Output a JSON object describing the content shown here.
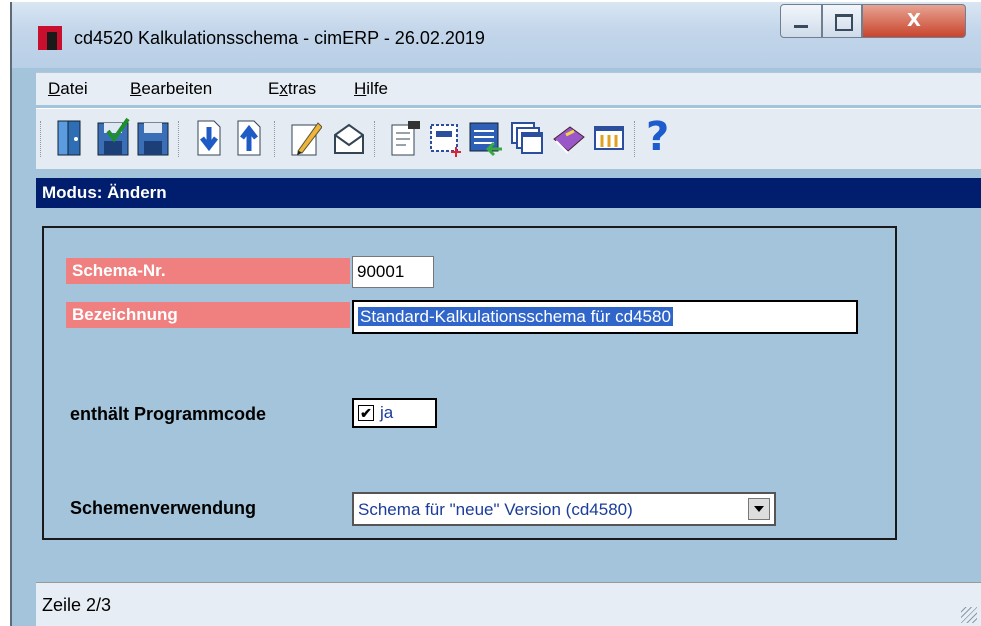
{
  "window": {
    "title": "cd4520 Kalkulationsschema - cimERP - 26.02.2019",
    "close_glyph": "X"
  },
  "menu": [
    {
      "label": "Datei",
      "access": "D",
      "rest": "atei"
    },
    {
      "label": "Bearbeiten",
      "access": "B",
      "rest": "earbeiten"
    },
    {
      "label": "Extras",
      "access": "x",
      "pre": "E",
      "rest": "tras"
    },
    {
      "label": "Hilfe",
      "access": "H",
      "rest": "ilfe"
    }
  ],
  "toolbar": {
    "icons": [
      "exit-door-icon",
      "save-checked-icon",
      "save-icon",
      "arrow-down-icon",
      "arrow-up-icon",
      "edit-pencil-icon",
      "mail-icon",
      "form-icon",
      "new-field-icon",
      "list-transfer-icon",
      "windows-icon",
      "book-icon",
      "grid-icon",
      "help-icon"
    ],
    "help_glyph": "?"
  },
  "mode": {
    "text": "Modus: Ändern"
  },
  "form": {
    "schema_nr": {
      "label": "Schema-Nr.",
      "value": "90001"
    },
    "bezeichnung": {
      "label": "Bezeichnung",
      "value": "Standard-Kalkulationsschema für cd4580"
    },
    "programmcode": {
      "label": "enthält Programmcode",
      "checked": true,
      "check_glyph": "✔",
      "option_label": "ja"
    },
    "verwendung": {
      "label": "Schemenverwendung",
      "value": "Schema für \"neue\" Version (cd4580)"
    }
  },
  "status": {
    "text": "Zeile 2/3"
  },
  "colors": {
    "mode_bar": "#001d6e",
    "label_red": "#f08080",
    "background": "#a3c4da"
  }
}
